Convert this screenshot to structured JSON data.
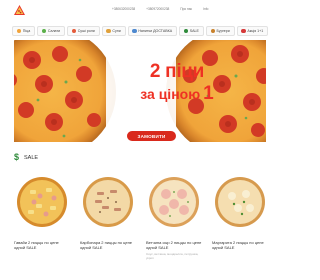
{
  "header": {
    "logo_icon": "pizza-logo-icon",
    "links": [
      "+380632000238",
      "+380972000238",
      "Про нас",
      "Info"
    ]
  },
  "categories": [
    {
      "label": "Піца",
      "icon": "pizza-icon",
      "color": "#f2a33a"
    },
    {
      "label": "Салати",
      "icon": "salad-icon",
      "color": "#5bb04a"
    },
    {
      "label": "Суші роли",
      "icon": "sushi-icon",
      "color": "#e45b3b"
    },
    {
      "label": "Супи",
      "icon": "soup-icon",
      "color": "#e0a13b"
    },
    {
      "label": "Напитки ДОСТАВКА",
      "icon": "drink-icon",
      "color": "#4e89cf"
    },
    {
      "label": "SALE",
      "icon": "dollar-icon",
      "color": "#2e8b3a"
    },
    {
      "label": "Бургери",
      "icon": "burger-icon",
      "color": "#c9822d"
    },
    {
      "label": "Акція 1+1",
      "icon": "gift-icon",
      "color": "#d63a3a"
    }
  ],
  "banner": {
    "title_line1": "2 піци",
    "title_line2": "за ціною",
    "title_number": "1",
    "button": "ЗАМОВИТИ",
    "accent": "#ee3124"
  },
  "sale": {
    "icon": "dollar-icon",
    "title": "SALE",
    "products": [
      {
        "name": "Гавайи 2 пиццы по цене одной SALE",
        "desc": ""
      },
      {
        "name": "Карбонара 2 пиццы по цене одной SALE",
        "desc": ""
      },
      {
        "name": "Ветчина сыр 2 пиццы по цене одной SALE",
        "desc": "Соус, ветчина, моцарелла, петрушка, укроп"
      },
      {
        "name": "Маргарита 2 пиццы по цене одной SALE",
        "desc": ""
      }
    ]
  }
}
